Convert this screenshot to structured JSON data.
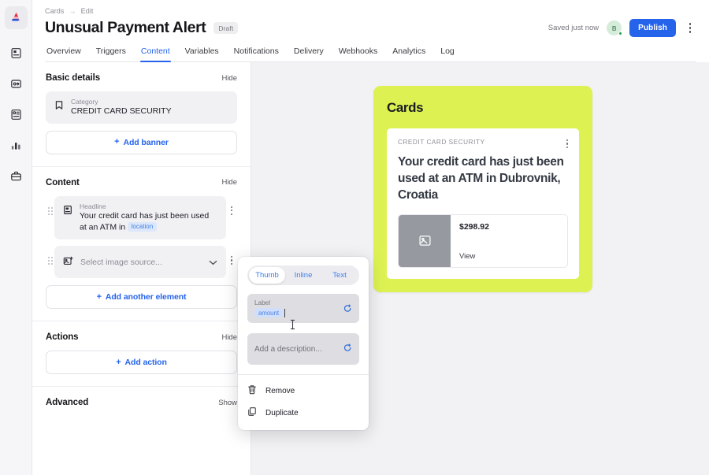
{
  "brand": {
    "accent_green": "#ddf252",
    "accent_blue": "#2563eb",
    "logo_name": "app-logo"
  },
  "rail": {
    "items": [
      {
        "name": "logo",
        "icon": "triangle-logo-icon"
      },
      {
        "name": "campaigns",
        "icon": "document-panel-icon"
      },
      {
        "name": "journeys",
        "icon": "flow-arrow-icon"
      },
      {
        "name": "templates",
        "icon": "settings-document-icon"
      },
      {
        "name": "analytics",
        "icon": "bar-chart-icon"
      },
      {
        "name": "toolbox",
        "icon": "briefcase-icon"
      }
    ]
  },
  "header": {
    "breadcrumb": {
      "root": "Cards",
      "arrow": "→",
      "current": "Edit"
    },
    "title": "Unusual Payment Alert",
    "status_badge": "Draft",
    "saved_text": "Saved just now",
    "avatar_initial": "B",
    "publish_label": "Publish",
    "more_icon": "kebab-menu-icon"
  },
  "tabs": [
    {
      "label": "Overview",
      "active": false
    },
    {
      "label": "Triggers",
      "active": false
    },
    {
      "label": "Content",
      "active": true
    },
    {
      "label": "Variables",
      "active": false
    },
    {
      "label": "Notifications",
      "active": false
    },
    {
      "label": "Delivery",
      "active": false
    },
    {
      "label": "Webhooks",
      "active": false
    },
    {
      "label": "Analytics",
      "active": false
    },
    {
      "label": "Log",
      "active": false
    }
  ],
  "editor": {
    "basic_details": {
      "title": "Basic details",
      "toggle": "Hide",
      "category_label": "Category",
      "category_value": "CREDIT CARD SECURITY",
      "category_icon": "bookmark-icon",
      "add_banner": "Add banner",
      "plus": "+"
    },
    "content": {
      "title": "Content",
      "toggle": "Hide",
      "headline_label": "Headline",
      "headline_text": "Your credit card has just been used at an ATM in",
      "headline_chip": "location",
      "headline_icon": "text-block-icon",
      "image_placeholder": "Select image source...",
      "image_icon": "add-image-icon",
      "add_element": "Add another element",
      "plus": "+"
    },
    "actions": {
      "title": "Actions",
      "toggle": "Hide",
      "add_action": "Add action",
      "plus": "+"
    },
    "advanced": {
      "title": "Advanced",
      "toggle": "Show"
    }
  },
  "popup": {
    "segments": [
      {
        "label": "Thumb",
        "active": true
      },
      {
        "label": "Inline",
        "active": false
      },
      {
        "label": "Text",
        "active": false
      }
    ],
    "label_field": {
      "label": "Label",
      "chip": "amount",
      "var_icon": "add-variable-icon"
    },
    "description_field": {
      "placeholder": "Add a description...",
      "var_icon": "add-variable-icon"
    },
    "menu": [
      {
        "label": "Remove",
        "icon": "trash-icon"
      },
      {
        "label": "Duplicate",
        "icon": "copy-icon"
      }
    ]
  },
  "preview": {
    "brand_title": "Cards",
    "category": "CREDIT CARD SECURITY",
    "headline": "Your credit card has just been used at an ATM in Dubrovnik, Croatia",
    "thumb_amount": "$298.92",
    "thumb_action": "View",
    "thumb_icon": "image-placeholder-icon",
    "card_more_icon": "kebab-menu-icon"
  }
}
